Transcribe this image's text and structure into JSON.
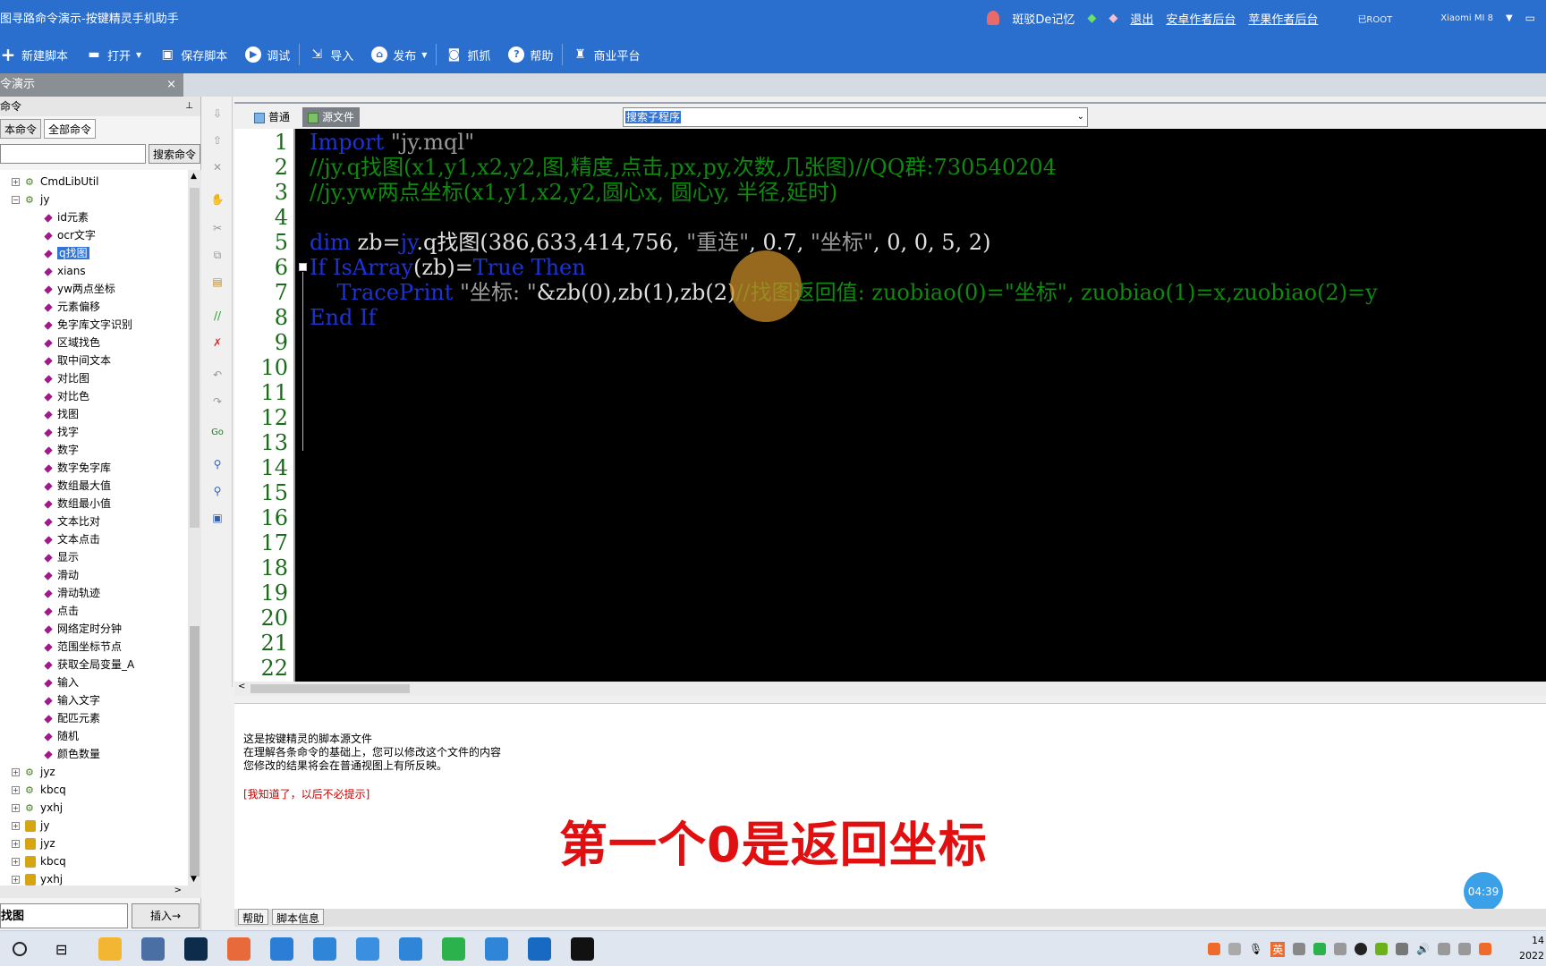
{
  "window": {
    "title": "图寻路命令演示-按键精灵手机助手",
    "user": "斑驳De记忆",
    "links": [
      "退出",
      "安卓作者后台",
      "苹果作者后台"
    ],
    "root_status": "已ROOT",
    "device": "Xiaomi  MI 8"
  },
  "toolbar": {
    "items": [
      {
        "label": "新建脚本",
        "icon": "plus-icon"
      },
      {
        "label": "打开",
        "icon": "folder-icon"
      },
      {
        "label": "保存脚本",
        "icon": "save-icon"
      },
      {
        "label": "调试",
        "icon": "play-icon"
      },
      {
        "label": "导入",
        "icon": "import-icon"
      },
      {
        "label": "发布",
        "icon": "publish-icon"
      },
      {
        "label": "抓抓",
        "icon": "camera-icon"
      },
      {
        "label": "帮助",
        "icon": "help-icon"
      },
      {
        "label": "商业平台",
        "icon": "money-bag-icon"
      }
    ]
  },
  "doc_tab": {
    "label": "令演示",
    "close": "×"
  },
  "left_panel": {
    "header": "命令",
    "tabs": [
      "本命令",
      "全部命令"
    ],
    "search_button": "搜索命令",
    "search_value": "",
    "tree_top": [
      {
        "label": "CmdLibUtil",
        "kind": "gear",
        "expander": "+"
      },
      {
        "label": "jy",
        "kind": "gear",
        "expander": "−"
      }
    ],
    "tree_children": [
      "id元素",
      "ocr文字",
      "q找图",
      "xians",
      "yw两点坐标",
      "元素偏移",
      "免字库文字识别",
      "区域找色",
      "取中间文本",
      "对比图",
      "对比色",
      "找图",
      "找字",
      "数字",
      "数字免字库",
      "数组最大值",
      "数组最小值",
      "文本比对",
      "文本点击",
      "显示",
      "滑动",
      "滑动轨迹",
      "点击",
      "网络定时分钟",
      "范围坐标节点",
      "获取全局变量_A",
      "输入",
      "输入文字",
      "配匹元素",
      "随机",
      "颜色数量"
    ],
    "selected_child": "q找图",
    "tree_bottom": [
      {
        "label": "jyz",
        "kind": "gear"
      },
      {
        "label": "kbcq",
        "kind": "gear"
      },
      {
        "label": "yxhj",
        "kind": "gear"
      },
      {
        "label": "jy",
        "kind": "lock"
      },
      {
        "label": "jyz",
        "kind": "lock"
      },
      {
        "label": "kbcq",
        "kind": "lock"
      },
      {
        "label": "yxhj",
        "kind": "lock"
      }
    ],
    "current_command": "找图",
    "insert_button": "插入→"
  },
  "editor": {
    "mode_normal": "普通",
    "mode_source": "源文件",
    "sub_select": "搜索子程序",
    "line_count": 22,
    "lines": [
      [
        {
          "t": "Import ",
          "c": "kw"
        },
        {
          "t": "\"jy.mql\"",
          "c": "st"
        }
      ],
      [
        {
          "t": "//jy.q找图(x1,y1,x2,y2,图,精度,点击,px,py,次数,几张图)//QQ群:730540204",
          "c": "cm"
        }
      ],
      [
        {
          "t": "//jy.yw两点坐标(x1,y1,x2,y2,圆心x, 圆心y, 半径,延时)",
          "c": "cm"
        }
      ],
      [],
      [
        {
          "t": "dim ",
          "c": "kw"
        },
        {
          "t": "zb=",
          "c": "df"
        },
        {
          "t": "jy",
          "c": "kw"
        },
        {
          "t": ".q找图(386,633,414,756, ",
          "c": "df"
        },
        {
          "t": "\"重连\"",
          "c": "st"
        },
        {
          "t": ", 0.7, ",
          "c": "df"
        },
        {
          "t": "\"坐标\"",
          "c": "st"
        },
        {
          "t": ", 0, 0, 5, 2)",
          "c": "df"
        }
      ],
      [
        {
          "t": "If ",
          "c": "kw"
        },
        {
          "t": "IsArray",
          "c": "kw"
        },
        {
          "t": "(zb)=",
          "c": "df"
        },
        {
          "t": "True ",
          "c": "kw"
        },
        {
          "t": "Then",
          "c": "kw"
        }
      ],
      [
        {
          "t": "    TracePrint ",
          "c": "kw"
        },
        {
          "t": "\"坐标: \"",
          "c": "st"
        },
        {
          "t": "&zb(0),zb(1),zb(2)",
          "c": "df"
        },
        {
          "t": "//找图返回值: zuobiao(0)=\"坐标\", zuobiao(1)=x,zuobiao(2)=y",
          "c": "cm"
        }
      ],
      [
        {
          "t": "End If",
          "c": "kw"
        }
      ]
    ]
  },
  "info": {
    "line1": "这是按键精灵的脚本源文件",
    "line2": "在理解各条命令的基础上，您可以修改这个文件的内容",
    "line3": "您修改的结果将会在普通视图上有所反映。",
    "dismiss": "[我知道了，以后不必提示]"
  },
  "overlay": {
    "subtitle": "第一个0是返回坐标",
    "timer": "04:39"
  },
  "bottom_tabs": [
    "帮助",
    "脚本信息"
  ],
  "taskbar": {
    "apps": [
      {
        "name": "explorer-icon",
        "color": "#f2b632"
      },
      {
        "name": "calculator-icon",
        "color": "#4a6fa5"
      },
      {
        "name": "photoshop-icon",
        "color": "#0d2b4a"
      },
      {
        "name": "color-picker-icon",
        "color": "#e86a3a"
      },
      {
        "name": "store-icon",
        "color": "#2c7dd6"
      },
      {
        "name": "robot-app-icon",
        "color": "#2f86d8"
      },
      {
        "name": "bird-app-icon",
        "color": "#3a8fe0"
      },
      {
        "name": "keysprite-icon",
        "color": "#2f86d8"
      },
      {
        "name": "wechat-icon",
        "color": "#2bb24c"
      },
      {
        "name": "remote-icon",
        "color": "#2f86d8"
      },
      {
        "name": "c-app-icon",
        "color": "#1769c2"
      },
      {
        "name": "capcut-icon",
        "color": "#111111"
      }
    ],
    "tray_ime": "英",
    "clock_time": "14",
    "clock_date": "2022"
  }
}
